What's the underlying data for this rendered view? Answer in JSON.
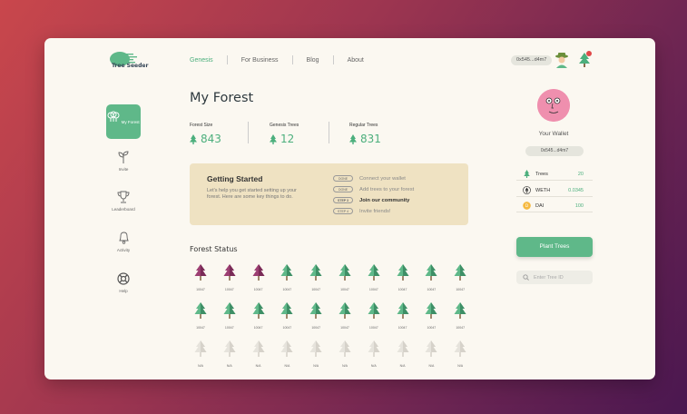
{
  "brand": {
    "logo_text": "Tree Seeder",
    "accent": "#5fb889"
  },
  "nav": {
    "items": [
      "Genesis",
      "For Business",
      "Blog",
      "About"
    ],
    "active": "Genesis"
  },
  "header": {
    "address": "0x545...d4m7"
  },
  "sidebar": {
    "items": [
      {
        "label": "My Forest",
        "icon": "forest-icon",
        "active": true
      },
      {
        "label": "Invite",
        "icon": "sprout-icon"
      },
      {
        "label": "Leaderboard",
        "icon": "trophy-icon"
      },
      {
        "label": "Activity",
        "icon": "bell-icon"
      },
      {
        "label": "Help",
        "icon": "lifebuoy-icon"
      }
    ]
  },
  "main": {
    "title": "My Forest",
    "stats": [
      {
        "label": "Forest Size",
        "value": "843"
      },
      {
        "label": "Genesis Trees",
        "value": "12"
      },
      {
        "label": "Regular Trees",
        "value": "831"
      }
    ],
    "getting_started": {
      "title": "Getting Started",
      "description": "Let's help you get started setting up your forest. Here are some key things to do.",
      "steps": [
        {
          "tag": "DONE",
          "text": "Connect your wallet",
          "state": "done"
        },
        {
          "tag": "DONE",
          "text": "Add trees to your forest",
          "state": "done"
        },
        {
          "tag": "STEP 3",
          "text": "Join our community",
          "state": "current"
        },
        {
          "tag": "STEP 4",
          "text": "Invite friends!",
          "state": "todo"
        }
      ]
    },
    "forest_status": {
      "title": "Forest Status",
      "rows": [
        {
          "kind": "mixed",
          "purple_count": 3,
          "label": "10047"
        },
        {
          "kind": "green",
          "label": "10047"
        },
        {
          "kind": "empty",
          "label": "N/A"
        }
      ],
      "per_row": 10
    }
  },
  "wallet": {
    "title": "Your Wallet",
    "address": "0x545...d4m7",
    "balances": [
      {
        "name": "Trees",
        "value": "20",
        "icon": "tree-icon"
      },
      {
        "name": "WETH",
        "value": "0.0345",
        "icon": "eth-icon"
      },
      {
        "name": "DAI",
        "value": "100",
        "icon": "dai-icon"
      }
    ],
    "plant_button": "Plant Trees",
    "search_placeholder": "Enter Tree ID"
  }
}
